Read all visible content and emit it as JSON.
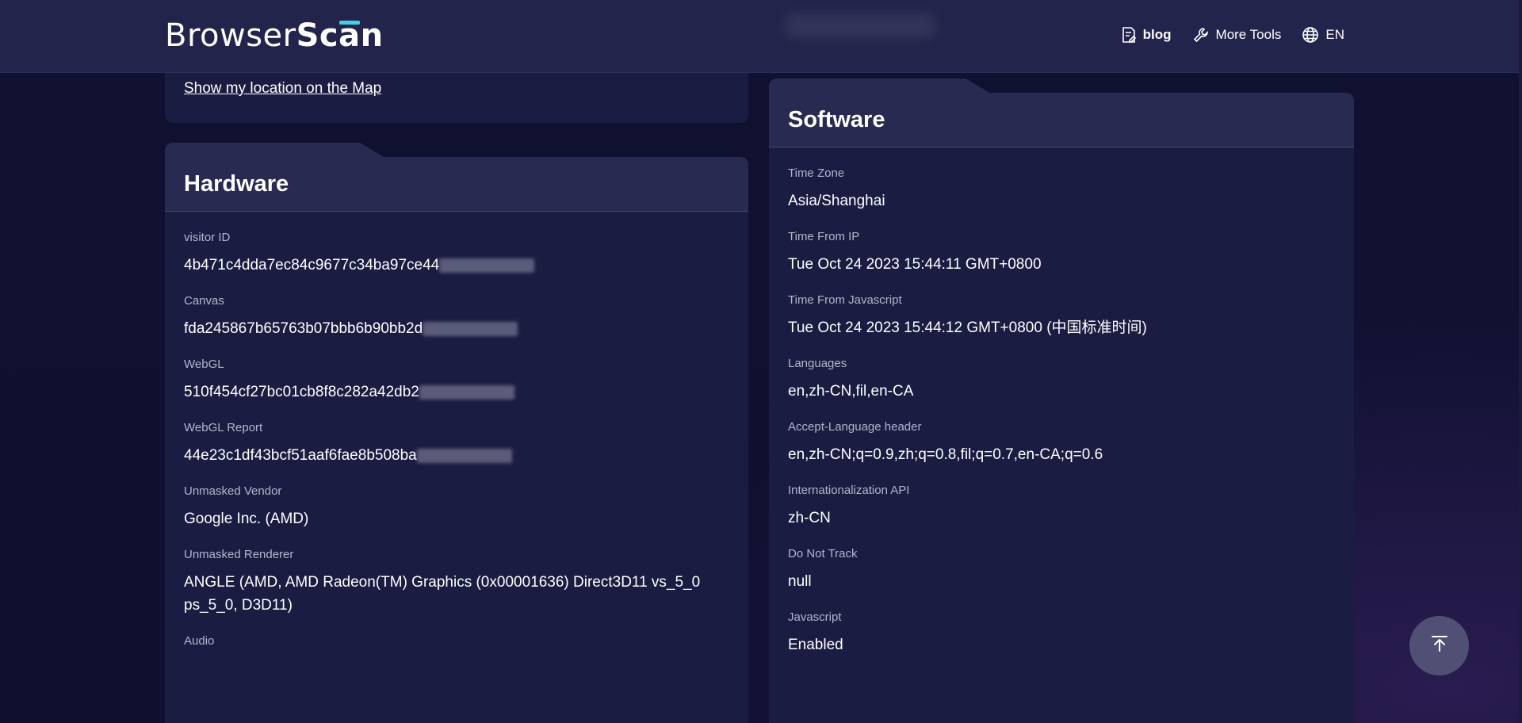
{
  "header": {
    "logo_light": "Browser",
    "logo_bold": "Scan",
    "nav": {
      "blog": "blog",
      "more_tools": "More Tools",
      "language": "EN"
    }
  },
  "location": {
    "map_link": "Show my location on the Map"
  },
  "hardware": {
    "title": "Hardware",
    "fields": [
      {
        "label": "visitor ID",
        "value": "4b471c4dda7ec84c9677c34ba97ce44"
      },
      {
        "label": "Canvas",
        "value": "fda245867b65763b07bbb6b90bb2d"
      },
      {
        "label": "WebGL",
        "value": "510f454cf27bc01cb8f8c282a42db2"
      },
      {
        "label": "WebGL Report",
        "value": "44e23c1df43bcf51aaf6fae8b508ba"
      },
      {
        "label": "Unmasked Vendor",
        "value": "Google Inc. (AMD)"
      },
      {
        "label": "Unmasked Renderer",
        "value": "ANGLE (AMD, AMD Radeon(TM) Graphics (0x00001636) Direct3D11 vs_5_0 ps_5_0, D3D11)"
      },
      {
        "label": "Audio",
        "value": ""
      }
    ]
  },
  "software": {
    "title": "Software",
    "fields": [
      {
        "label": "Time Zone",
        "value": "Asia/Shanghai"
      },
      {
        "label": "Time From IP",
        "value": "Tue Oct 24 2023 15:44:11 GMT+0800"
      },
      {
        "label": "Time From Javascript",
        "value": "Tue Oct 24 2023 15:44:12 GMT+0800 (中国标准时间)"
      },
      {
        "label": "Languages",
        "value": "en,zh-CN,fil,en-CA"
      },
      {
        "label": "Accept-Language header",
        "value": "en,zh-CN;q=0.9,zh;q=0.8,fil;q=0.7,en-CA;q=0.6"
      },
      {
        "label": "Internationalization API",
        "value": "zh-CN"
      },
      {
        "label": "Do Not Track",
        "value": "null"
      },
      {
        "label": "Javascript",
        "value": "Enabled"
      }
    ]
  },
  "colors": {
    "accent": "#3fd1e6",
    "background": "#0e0f2e",
    "card": "#1b1c42",
    "header": "#23244b"
  },
  "icons": {
    "blog": "document-pen-icon",
    "tools": "wrench-icon",
    "language": "globe-icon",
    "to_top": "arrow-up-to-line-icon"
  }
}
